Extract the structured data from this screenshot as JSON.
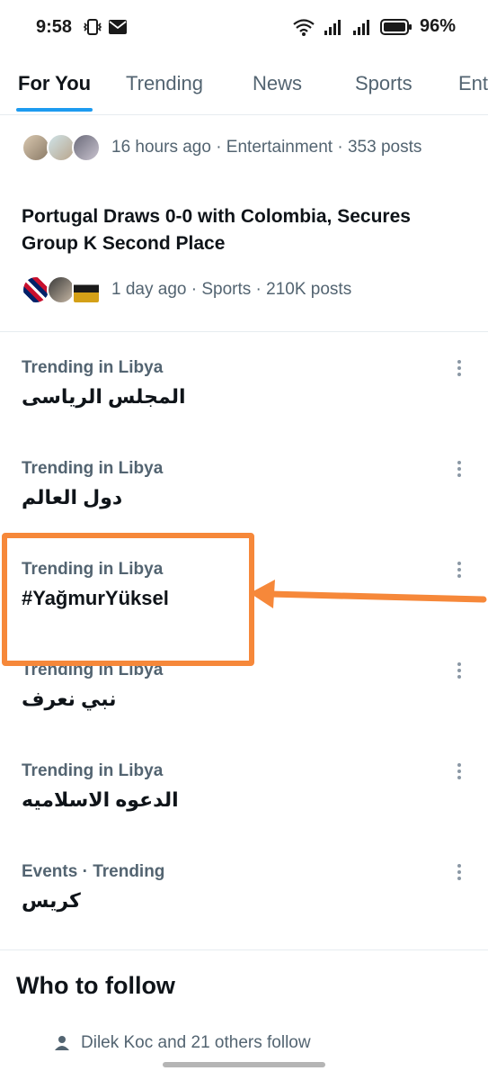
{
  "status_bar": {
    "time": "9:58",
    "battery": "96%"
  },
  "tabs": [
    {
      "label": "For You",
      "active": true
    },
    {
      "label": "Trending",
      "active": false
    },
    {
      "label": "News",
      "active": false
    },
    {
      "label": "Sports",
      "active": false
    },
    {
      "label": "Ent",
      "active": false
    }
  ],
  "news": [
    {
      "meta": "16 hours ago · Entertainment · 353 posts",
      "headline": ""
    },
    {
      "meta": "1 day ago · Sports · 210K posts",
      "headline": "Portugal Draws 0-0 with Colombia, Secures Group K Second Place"
    }
  ],
  "trends": [
    {
      "context": "Trending in Libya",
      "name": "المجلس الرياسى"
    },
    {
      "context": "Trending in Libya",
      "name": "دول العالم"
    },
    {
      "context": "Trending in Libya",
      "name": "#YağmurYüksel"
    },
    {
      "context": "Trending in Libya",
      "name": "نبي نعرف"
    },
    {
      "context": "Trending in Libya",
      "name": "الدعوه الاسلاميه"
    },
    {
      "context": "Events · Trending",
      "name": "كريس"
    }
  ],
  "who_to_follow": {
    "title": "Who to follow",
    "social_context": "Dilek Koc and 21 others follow"
  },
  "colors": {
    "accent": "#1d9bf0",
    "annotation": "#f6883a",
    "secondary_text": "#536471"
  }
}
